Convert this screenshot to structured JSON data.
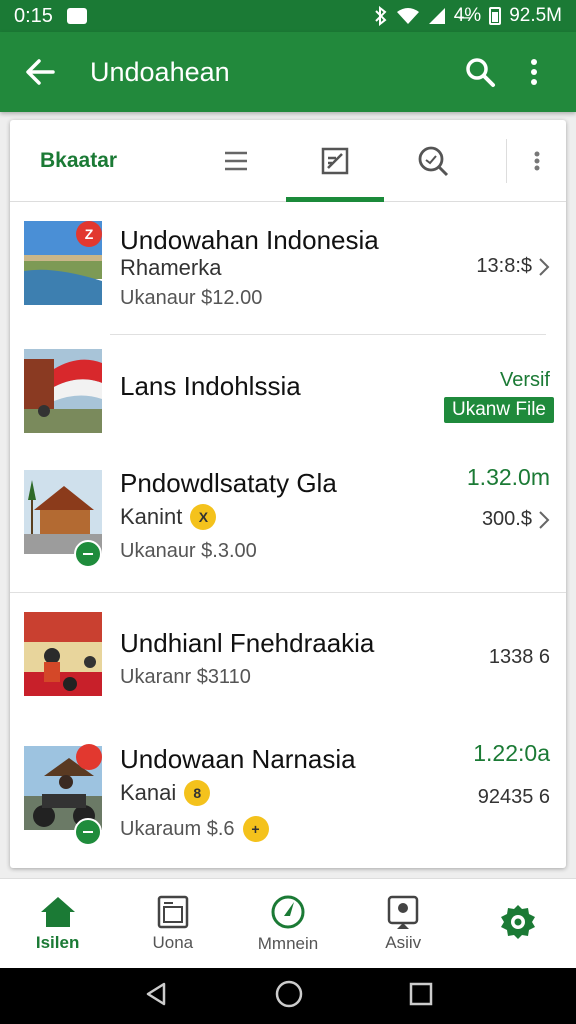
{
  "status_bar": {
    "time": "0:15",
    "battery_text": "4̶%",
    "speed_text": "92.5M"
  },
  "app_bar": {
    "title": "Undoahean",
    "back_icon": "arrow-left-icon",
    "search_icon": "search-icon",
    "more_icon": "more-vert-icon"
  },
  "tabs": {
    "brand": "Bkaatar",
    "items": [
      "list-icon",
      "edit-note-icon",
      "search-zoom-icon"
    ],
    "active_index": 1
  },
  "items": [
    {
      "title": "Undowahan Indonesia",
      "subtitle": "Rhamerka",
      "price": "Ukanaur $12.00",
      "right_text": "13:8:$",
      "badge": "Z"
    },
    {
      "title": "Lans Indohlssia",
      "right_green": "Versif",
      "tag": "Ukanw File"
    },
    {
      "title": "Pndowdlsataty Gla",
      "subtitle": "Kanint",
      "coin": "X",
      "price": "Ukanaur $.3.00",
      "right_green": "1.32.0m",
      "right_text": "300.$"
    },
    {
      "title": "Undhianl Fnehdraakia",
      "price": "Ukaranr $3110",
      "right_text": "1338 6"
    },
    {
      "title": "Undowaan Narnasia",
      "subtitle": "Kanai",
      "coin": "8",
      "price": "Ukaraum $.6",
      "coin2": "+",
      "right_green": "1.22:0a",
      "right_text": "92435 6"
    }
  ],
  "bottom_nav": [
    {
      "label": "Isilen",
      "icon": "home-icon",
      "active": true
    },
    {
      "label": "Uona",
      "icon": "folder-icon",
      "active": false
    },
    {
      "label": "Mmnein",
      "icon": "compass-icon",
      "active": false
    },
    {
      "label": "Asiiv",
      "icon": "account-box-icon",
      "active": false
    },
    {
      "label": "",
      "icon": "settings-icon",
      "active": false
    }
  ],
  "colors": {
    "primary": "#22893c",
    "primary_dark": "#1b7a35",
    "accent_red": "#e2382f",
    "coin": "#f4c21c"
  }
}
